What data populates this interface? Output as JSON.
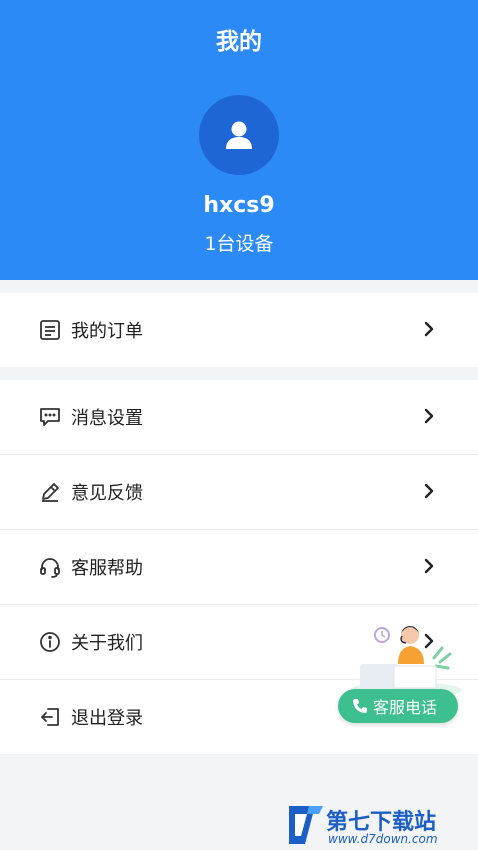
{
  "header": {
    "title": "我的",
    "username": "hxcs9",
    "devices": "1台设备"
  },
  "menu_group_1": [
    {
      "label": "我的订单",
      "icon": "order-list-icon"
    }
  ],
  "menu_group_2": [
    {
      "label": "消息设置",
      "icon": "message-icon"
    },
    {
      "label": "意见反馈",
      "icon": "pencil-icon"
    },
    {
      "label": "客服帮助",
      "icon": "headset-icon"
    },
    {
      "label": "关于我们",
      "icon": "info-icon"
    },
    {
      "label": "退出登录",
      "icon": "logout-icon"
    }
  ],
  "customer_service": {
    "label": "客服电话"
  },
  "watermark": {
    "text": "第七下载站",
    "url": "www.d7down.com"
  },
  "colors": {
    "header_bg": "#2b8af5",
    "avatar_bg": "#1e66d6",
    "cs_button": "#3dbf8f"
  }
}
